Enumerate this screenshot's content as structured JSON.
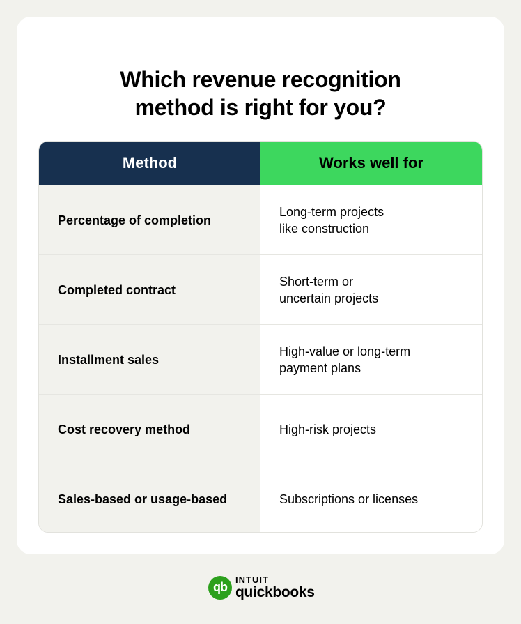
{
  "title": "Which revenue recognition method is right for you?",
  "title_lines": [
    "Which revenue recognition",
    "method is right for you?"
  ],
  "table": {
    "headers": [
      "Method",
      "Works well for"
    ],
    "header_colors": {
      "method": "#17304f",
      "works": "#3dd75e"
    },
    "rows": [
      {
        "method": "Percentage of completion",
        "works": "Long-term projects\nlike construction"
      },
      {
        "method": "Completed contract",
        "works": "Short-term or\nuncertain projects"
      },
      {
        "method": "Installment sales",
        "works": "High-value or long-term\npayment plans"
      },
      {
        "method": "Cost recovery method",
        "works": "High-risk projects"
      },
      {
        "method": "Sales-based or usage-based",
        "works": "Subscriptions or licenses"
      }
    ]
  },
  "logo": {
    "icon": "qb",
    "brand": "INTUIT",
    "product": "quickbooks",
    "color": "#2ca01c"
  }
}
